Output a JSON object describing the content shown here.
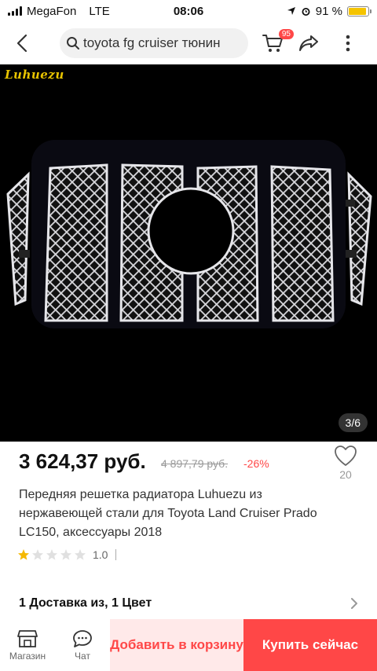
{
  "status_bar": {
    "carrier": "MegaFon",
    "network": "LTE",
    "time": "08:06",
    "battery": "91 %",
    "battery_level": 0.91
  },
  "header": {
    "search_query": "toyota fg cruiser тюнин",
    "cart_count": "95"
  },
  "gallery": {
    "brand_logo": "Luhuezu",
    "counter": "3/6"
  },
  "product": {
    "price": "3 624,37 руб.",
    "old_price": "4 897,79 руб.",
    "discount": "-26%",
    "wishlist_count": "20",
    "title": "Передняя решетка радиатора Luhuezu из нержавеющей стали для Toyota Land Cruiser Prado LC150, аксессуары 2018",
    "rating": "1.0",
    "stars_filled": 1,
    "stars_total": 5
  },
  "delivery": {
    "text": "1 Доставка из, 1 Цвет"
  },
  "bottom_bar": {
    "shop_label": "Магазин",
    "chat_label": "Чат",
    "add_to_cart": "Добавить в корзину",
    "buy_now": "Купить сейчас"
  },
  "colors": {
    "accent": "#ff4747",
    "accent_light": "#ffe9e9",
    "star": "#f5b800"
  }
}
